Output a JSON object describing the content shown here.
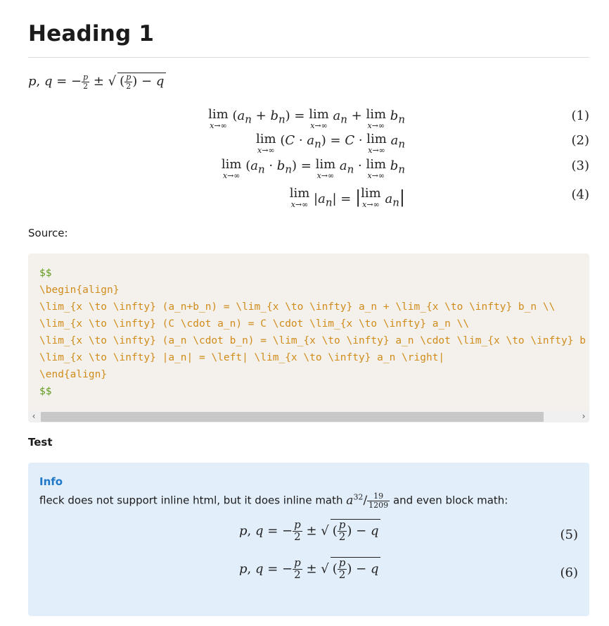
{
  "heading": "Heading 1",
  "inline_formula": "p, q = −p/2 ± √((p/2) − q)",
  "equations": [
    {
      "lhs_lim": "lim",
      "lhs_sub": "x→∞",
      "lhs": "(aₙ + bₙ) =",
      "rhs": "lim aₙ + lim bₙ",
      "number": "(1)"
    },
    {
      "lhs_lim": "lim",
      "lhs_sub": "x→∞",
      "lhs": "(C · aₙ) =",
      "rhs": "C · lim aₙ",
      "number": "(2)"
    },
    {
      "lhs_lim": "lim",
      "lhs_sub": "x→∞",
      "lhs": "(aₙ · bₙ) =",
      "rhs": "lim aₙ · lim bₙ",
      "number": "(3)"
    },
    {
      "lhs_lim": "lim",
      "lhs_sub": "x→∞",
      "lhs": "|aₙ| =",
      "rhs": "| lim aₙ |",
      "number": "(4)"
    }
  ],
  "source_label": "Source:",
  "code_lines": [
    "$$",
    "\\begin{align}",
    "\\lim_{x \\to \\infty} (a_n+b_n) = \\lim_{x \\to \\infty} a_n + \\lim_{x \\to \\infty} b_n \\\\",
    "\\lim_{x \\to \\infty} (C \\cdot a_n) = C \\cdot \\lim_{x \\to \\infty} a_n \\\\",
    "\\lim_{x \\to \\infty} (a_n \\cdot b_n) = \\lim_{x \\to \\infty} a_n \\cdot \\lim_{x \\to \\infty} b",
    "\\lim_{x \\to \\infty} |a_n| = \\left| \\lim_{x \\to \\infty} a_n \\right|",
    "\\end{align}",
    "$$"
  ],
  "test_label": "Test",
  "info": {
    "title": "Info",
    "text_before": "fleck does not support inline html, but it does inline math",
    "text_after": "and even block math:",
    "frac_num": "19",
    "frac_den": "1209",
    "eq_numbers": [
      "(5)",
      "(6)"
    ]
  },
  "colors": {
    "accent": "#1f79c8",
    "info_bg": "#e3eefb",
    "code_bg": "#f4f1ec",
    "code_green": "#5f9a1d",
    "code_orange": "#d08c1b"
  }
}
